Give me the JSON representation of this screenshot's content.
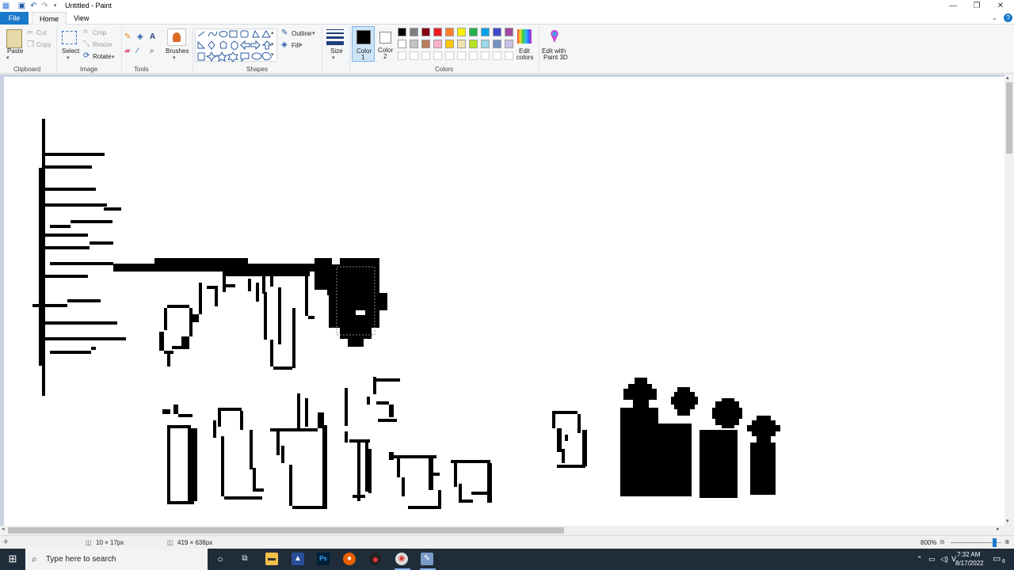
{
  "window": {
    "title": "Untitled - Paint"
  },
  "quick_access": {
    "save_icon": "save-icon",
    "undo_icon": "undo-icon",
    "redo_icon": "redo-icon"
  },
  "tabs": {
    "file": "File",
    "home": "Home",
    "view": "View"
  },
  "ribbon": {
    "clipboard": {
      "paste": "Paste",
      "cut": "Cut",
      "copy": "Copy",
      "group": "Clipboard"
    },
    "image": {
      "select": "Select",
      "crop": "Crop",
      "resize": "Resize",
      "rotate": "Rotate",
      "group": "Image"
    },
    "tools": {
      "group": "Tools"
    },
    "brushes": {
      "label": "Brushes"
    },
    "shapes": {
      "outline": "Outline",
      "fill": "Fill",
      "group": "Shapes"
    },
    "size": {
      "label": "Size"
    },
    "color1": {
      "label": "Color",
      "sub": "1",
      "value": "#000000"
    },
    "color2": {
      "label": "Color",
      "sub": "2",
      "value": "#ffffff"
    },
    "colors": {
      "group": "Colors",
      "edit": "Edit colors",
      "edit_line1": "Edit",
      "edit_line2": "colors",
      "paint3d_line1": "Edit with",
      "paint3d_line2": "Paint 3D",
      "palette_row1": [
        "#000000",
        "#7f7f7f",
        "#880015",
        "#ed1c24",
        "#ff7f27",
        "#fff200",
        "#22b14c",
        "#00a2e8",
        "#3f48cc",
        "#a349a4"
      ],
      "palette_row2": [
        "#ffffff",
        "#c3c3c3",
        "#b97a57",
        "#ffaec9",
        "#ffc90e",
        "#efe4b0",
        "#b5e61d",
        "#99d9ea",
        "#7092be",
        "#c8bfe7"
      ]
    }
  },
  "status": {
    "selection_size": "10 × 17px",
    "image_size": "419 × 638px",
    "zoom": "800%"
  },
  "taskbar": {
    "search_placeholder": "Type here to search",
    "time": "7:32 AM",
    "date": "8/17/2022",
    "notifications": "6"
  }
}
